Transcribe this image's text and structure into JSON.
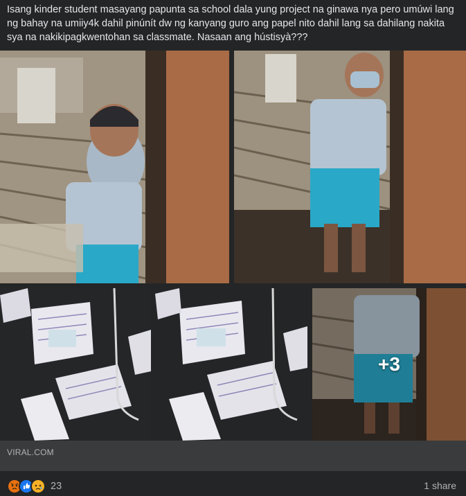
{
  "post": {
    "caption": "Isang kinder student masayang papunta sa school dala yung project na ginawa nya pero umúwi lang ng bahay na umiiy4k dahil pinúnít dw ng kanyang guro ang papel nito dahil lang sa dahilang nakita sya na nakikipagkwentohan sa classmate. Nasaan ang hústisyà???"
  },
  "photos": {
    "more_count": "+3"
  },
  "link_preview": {
    "domain": "VIRAL.COM"
  },
  "footer": {
    "reaction_icons": [
      "angry-icon",
      "like-icon",
      "sad-icon"
    ],
    "reaction_count": "23",
    "share_count": "1 share"
  },
  "colors": {
    "background": "#242526",
    "link_bar": "#3a3b3c",
    "text_primary": "#e4e6eb",
    "text_secondary": "#b0b3b8",
    "like": "#1877f2",
    "angry": "#e9710f",
    "sad": "#f7b125"
  }
}
